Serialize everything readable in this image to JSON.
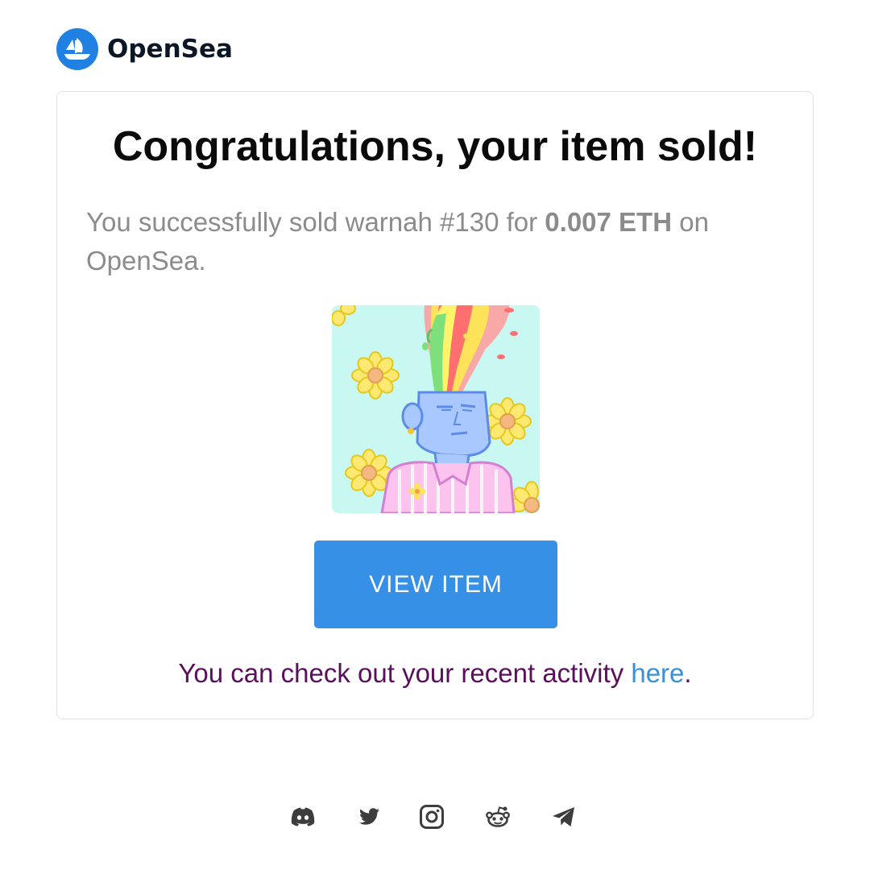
{
  "brand": {
    "name": "OpenSea",
    "logo_icon": "opensea-logo-icon",
    "logo_color": "#2081e2"
  },
  "card": {
    "title": "Congratulations, your item sold!",
    "message": {
      "prefix": "You successfully sold warnah #130 for ",
      "price": "0.007 ETH",
      "suffix": " on OpenSea."
    },
    "image": {
      "icon": "nft-artwork-image",
      "description_alt": "warnah #130"
    },
    "button_label": "VIEW ITEM",
    "button_color": "#3691e6",
    "activity": {
      "text": "You can check out your recent activity ",
      "link_label": "here",
      "end": "."
    }
  },
  "footer": {
    "socials": [
      {
        "name": "discord",
        "icon": "discord-icon"
      },
      {
        "name": "twitter",
        "icon": "twitter-icon"
      },
      {
        "name": "instagram",
        "icon": "instagram-icon"
      },
      {
        "name": "reddit",
        "icon": "reddit-icon"
      },
      {
        "name": "telegram",
        "icon": "telegram-icon"
      }
    ]
  },
  "colors": {
    "title": "#0a0a0a",
    "message": "#8b8b8b",
    "activity_text": "#5a0f5c",
    "link": "#3a8fd6",
    "social_icon": "#3d3d3d"
  }
}
